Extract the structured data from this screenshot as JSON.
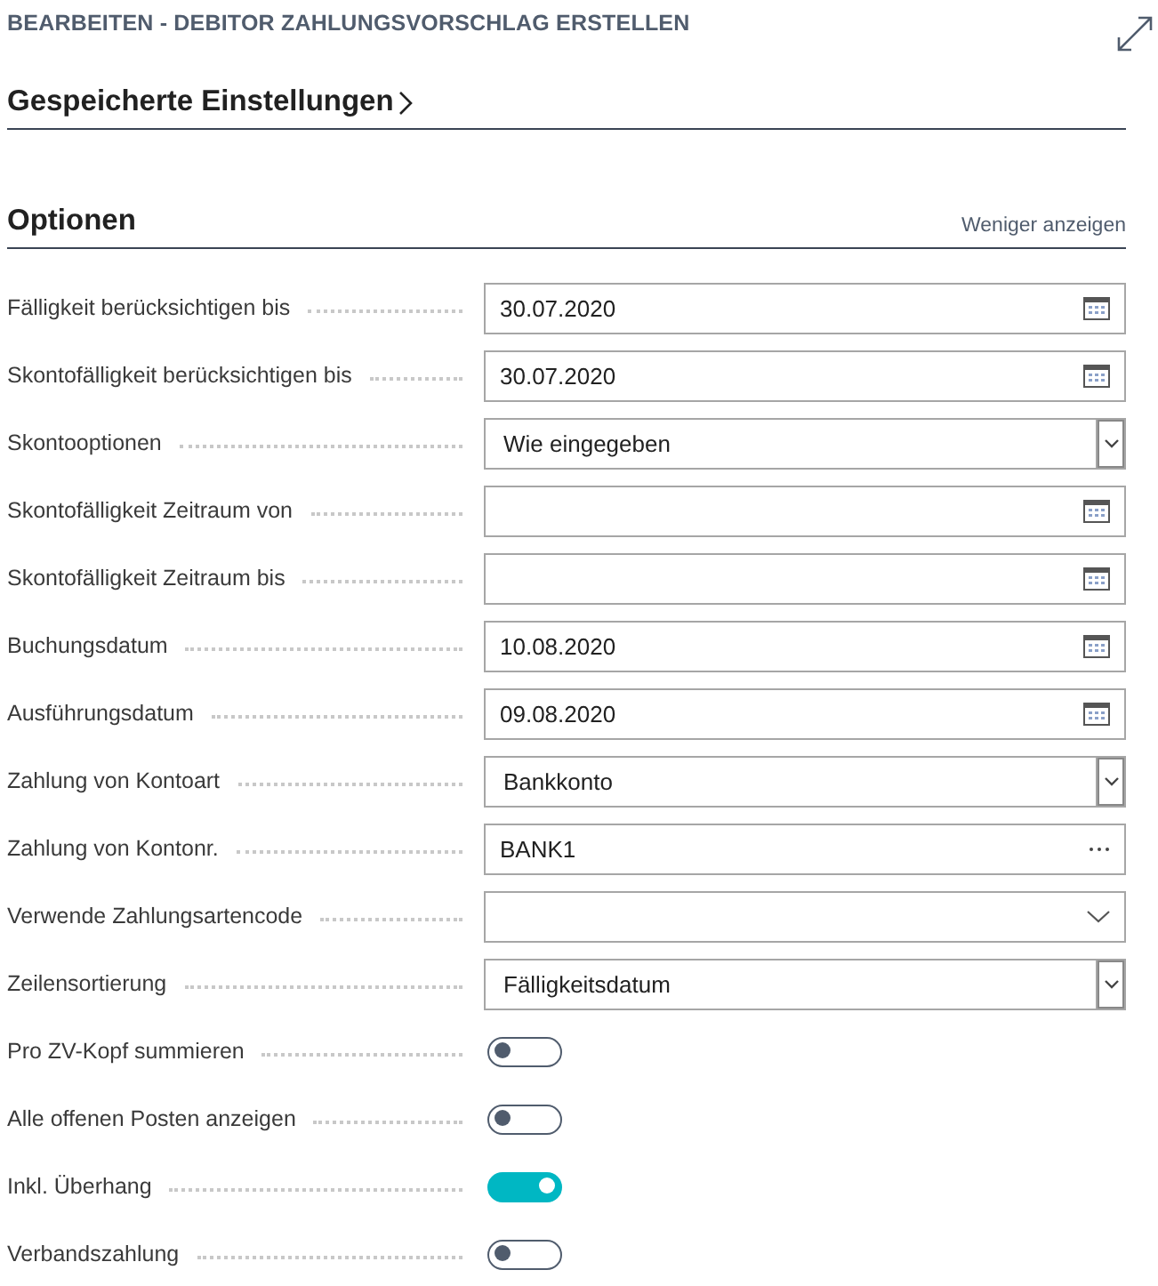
{
  "window": {
    "title": "BEARBEITEN - DEBITOR ZAHLUNGSVORSCHLAG ERSTELLEN"
  },
  "saved_settings": {
    "title": "Gespeicherte Einstellungen",
    "expanded": false
  },
  "options": {
    "title": "Optionen",
    "toggle_link": "Weniger anzeigen",
    "fields": [
      {
        "label": "Fälligkeit berücksichtigen bis",
        "kind": "date",
        "value": "30.07.2020"
      },
      {
        "label": "Skontofälligkeit berücksichtigen bis",
        "kind": "date",
        "value": "30.07.2020"
      },
      {
        "label": "Skontooptionen",
        "kind": "select",
        "value": "Wie eingegeben"
      },
      {
        "label": "Skontofälligkeit Zeitraum von",
        "kind": "date"
      },
      {
        "label": "Skontofälligkeit Zeitraum bis",
        "kind": "date"
      },
      {
        "label": "Buchungsdatum",
        "kind": "date",
        "value": "10.08.2020"
      },
      {
        "label": "Ausführungsdatum",
        "kind": "date",
        "value": "09.08.2020"
      },
      {
        "label": "Zahlung von Kontoart",
        "kind": "select",
        "value": "Bankkonto"
      },
      {
        "label": "Zahlung von Kontonr.",
        "kind": "lookup",
        "value": "BANK1"
      },
      {
        "label": "Verwende Zahlungsartencode",
        "kind": "dropdown"
      },
      {
        "label": "Zeilensortierung",
        "kind": "select",
        "value": "Fälligkeitsdatum"
      },
      {
        "label": "Pro ZV-Kopf summieren",
        "kind": "toggle",
        "on": false
      },
      {
        "label": "Alle offenen Posten anzeigen",
        "kind": "toggle",
        "on": false
      },
      {
        "label": "Inkl. Überhang",
        "kind": "toggle",
        "on": true
      },
      {
        "label": "Verbandszahlung",
        "kind": "toggle",
        "on": false
      }
    ]
  }
}
